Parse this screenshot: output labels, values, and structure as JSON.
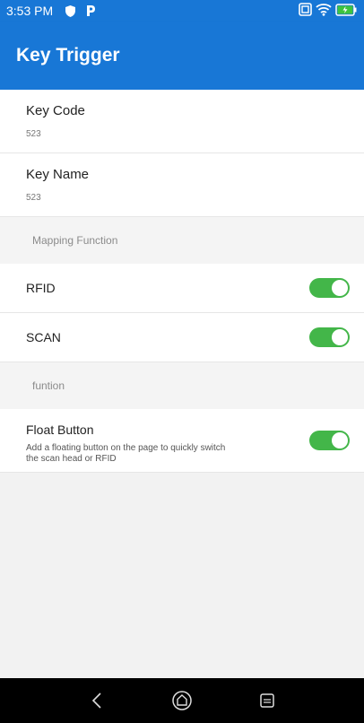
{
  "status_bar": {
    "time": "3:53 PM",
    "icons_left": [
      "shield-icon",
      "parking-p-icon"
    ],
    "icons_right": [
      "nfc-icon",
      "wifi-icon",
      "battery-charging-icon"
    ]
  },
  "app_bar": {
    "title": "Key Trigger",
    "color": "#1877d6"
  },
  "key_code": {
    "label": "Key Code",
    "value": "523"
  },
  "key_name": {
    "label": "Key Name",
    "value": "523"
  },
  "section_mapping": {
    "label": "Mapping Function"
  },
  "rfid": {
    "label": "RFID",
    "enabled": true
  },
  "scan": {
    "label": "SCAN",
    "enabled": true
  },
  "section_function": {
    "label": "funtion"
  },
  "float_button": {
    "label": "Float Button",
    "description": "Add a floating button on the page to quickly switch the scan head or RFID",
    "enabled": true
  },
  "nav_bar": {
    "buttons": [
      "back-icon",
      "home-icon",
      "recents-icon"
    ]
  },
  "colors": {
    "toggle_on": "#43b649"
  }
}
